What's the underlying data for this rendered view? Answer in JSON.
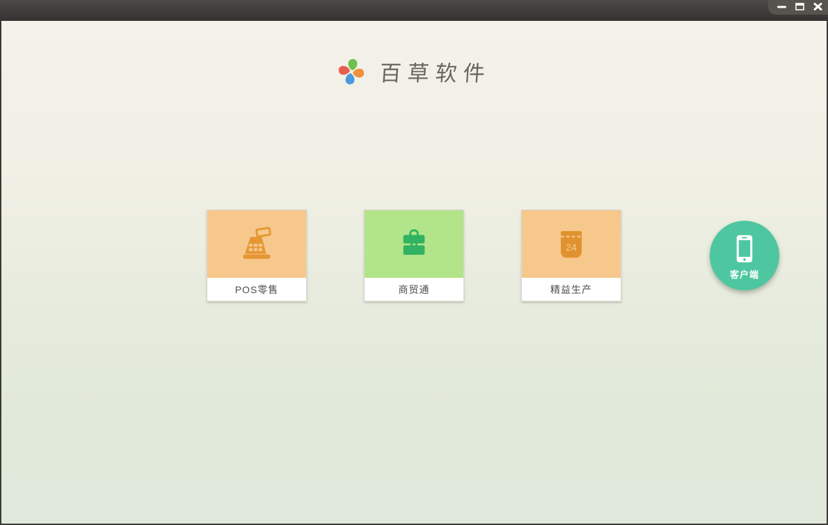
{
  "window": {
    "title_bar": {
      "controls": [
        {
          "name": "minimize"
        },
        {
          "name": "maximize"
        },
        {
          "name": "close"
        }
      ]
    }
  },
  "header": {
    "app_name": "百草软件",
    "logo": "pinwheel-logo",
    "logo_colors": {
      "top": "#6cc04b",
      "right": "#f0923b",
      "bottom": "#4d9ade",
      "left": "#e55f4b"
    }
  },
  "products": [
    {
      "label": "POS零售",
      "icon": "cash-register-icon",
      "tile_color": "#f6c88c",
      "icon_color": "#e49733"
    },
    {
      "label": "商贸通",
      "icon": "briefcase-icon",
      "tile_color": "#b2e489",
      "icon_color": "#2fb261"
    },
    {
      "label": "精益生产",
      "icon": "calendar-icon",
      "tile_color": "#f6c88c",
      "icon_color": "#e0922f",
      "calendar_day": "24"
    }
  ],
  "client_button": {
    "label": "客户端",
    "icon": "smartphone-icon",
    "color": "#4ec7a0"
  },
  "colors": {
    "titlebar": "#403f3d",
    "controls_tab": "#56544f",
    "background_top": "#f4f2eb",
    "background_bottom": "#dfe8da",
    "card_shadow": "rgba(60,60,50,0.22)"
  }
}
